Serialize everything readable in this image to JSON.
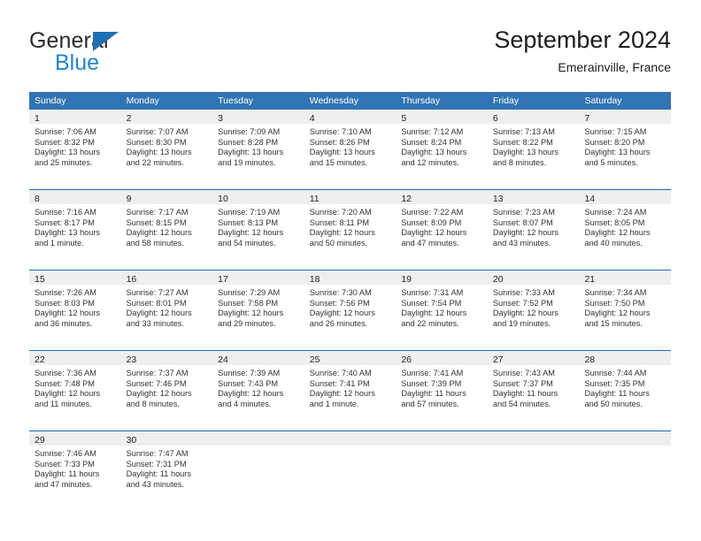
{
  "branding": {
    "name_top": "General",
    "name_bottom": "Blue",
    "triangle_color": "#1f6fb5",
    "bottom_color": "#1f86d0"
  },
  "header": {
    "title": "September 2024",
    "subtitle": "Emerainville, France"
  },
  "theme": {
    "header_blue": "#3174b5",
    "rule_blue": "#1f6fb5",
    "day_band_gray": "#efefef",
    "text_color": "#333333"
  },
  "weekdays": [
    "Sunday",
    "Monday",
    "Tuesday",
    "Wednesday",
    "Thursday",
    "Friday",
    "Saturday"
  ],
  "weeks": [
    [
      {
        "day": "1",
        "sunrise": "Sunrise: 7:06 AM",
        "sunset": "Sunset: 8:32 PM",
        "daylight_line1": "Daylight: 13 hours",
        "daylight_line2": "and 25 minutes."
      },
      {
        "day": "2",
        "sunrise": "Sunrise: 7:07 AM",
        "sunset": "Sunset: 8:30 PM",
        "daylight_line1": "Daylight: 13 hours",
        "daylight_line2": "and 22 minutes."
      },
      {
        "day": "3",
        "sunrise": "Sunrise: 7:09 AM",
        "sunset": "Sunset: 8:28 PM",
        "daylight_line1": "Daylight: 13 hours",
        "daylight_line2": "and 19 minutes."
      },
      {
        "day": "4",
        "sunrise": "Sunrise: 7:10 AM",
        "sunset": "Sunset: 8:26 PM",
        "daylight_line1": "Daylight: 13 hours",
        "daylight_line2": "and 15 minutes."
      },
      {
        "day": "5",
        "sunrise": "Sunrise: 7:12 AM",
        "sunset": "Sunset: 8:24 PM",
        "daylight_line1": "Daylight: 13 hours",
        "daylight_line2": "and 12 minutes."
      },
      {
        "day": "6",
        "sunrise": "Sunrise: 7:13 AM",
        "sunset": "Sunset: 8:22 PM",
        "daylight_line1": "Daylight: 13 hours",
        "daylight_line2": "and 8 minutes."
      },
      {
        "day": "7",
        "sunrise": "Sunrise: 7:15 AM",
        "sunset": "Sunset: 8:20 PM",
        "daylight_line1": "Daylight: 13 hours",
        "daylight_line2": "and 5 minutes."
      }
    ],
    [
      {
        "day": "8",
        "sunrise": "Sunrise: 7:16 AM",
        "sunset": "Sunset: 8:17 PM",
        "daylight_line1": "Daylight: 13 hours",
        "daylight_line2": "and 1 minute."
      },
      {
        "day": "9",
        "sunrise": "Sunrise: 7:17 AM",
        "sunset": "Sunset: 8:15 PM",
        "daylight_line1": "Daylight: 12 hours",
        "daylight_line2": "and 58 minutes."
      },
      {
        "day": "10",
        "sunrise": "Sunrise: 7:19 AM",
        "sunset": "Sunset: 8:13 PM",
        "daylight_line1": "Daylight: 12 hours",
        "daylight_line2": "and 54 minutes."
      },
      {
        "day": "11",
        "sunrise": "Sunrise: 7:20 AM",
        "sunset": "Sunset: 8:11 PM",
        "daylight_line1": "Daylight: 12 hours",
        "daylight_line2": "and 50 minutes."
      },
      {
        "day": "12",
        "sunrise": "Sunrise: 7:22 AM",
        "sunset": "Sunset: 8:09 PM",
        "daylight_line1": "Daylight: 12 hours",
        "daylight_line2": "and 47 minutes."
      },
      {
        "day": "13",
        "sunrise": "Sunrise: 7:23 AM",
        "sunset": "Sunset: 8:07 PM",
        "daylight_line1": "Daylight: 12 hours",
        "daylight_line2": "and 43 minutes."
      },
      {
        "day": "14",
        "sunrise": "Sunrise: 7:24 AM",
        "sunset": "Sunset: 8:05 PM",
        "daylight_line1": "Daylight: 12 hours",
        "daylight_line2": "and 40 minutes."
      }
    ],
    [
      {
        "day": "15",
        "sunrise": "Sunrise: 7:26 AM",
        "sunset": "Sunset: 8:03 PM",
        "daylight_line1": "Daylight: 12 hours",
        "daylight_line2": "and 36 minutes."
      },
      {
        "day": "16",
        "sunrise": "Sunrise: 7:27 AM",
        "sunset": "Sunset: 8:01 PM",
        "daylight_line1": "Daylight: 12 hours",
        "daylight_line2": "and 33 minutes."
      },
      {
        "day": "17",
        "sunrise": "Sunrise: 7:29 AM",
        "sunset": "Sunset: 7:58 PM",
        "daylight_line1": "Daylight: 12 hours",
        "daylight_line2": "and 29 minutes."
      },
      {
        "day": "18",
        "sunrise": "Sunrise: 7:30 AM",
        "sunset": "Sunset: 7:56 PM",
        "daylight_line1": "Daylight: 12 hours",
        "daylight_line2": "and 26 minutes."
      },
      {
        "day": "19",
        "sunrise": "Sunrise: 7:31 AM",
        "sunset": "Sunset: 7:54 PM",
        "daylight_line1": "Daylight: 12 hours",
        "daylight_line2": "and 22 minutes."
      },
      {
        "day": "20",
        "sunrise": "Sunrise: 7:33 AM",
        "sunset": "Sunset: 7:52 PM",
        "daylight_line1": "Daylight: 12 hours",
        "daylight_line2": "and 19 minutes."
      },
      {
        "day": "21",
        "sunrise": "Sunrise: 7:34 AM",
        "sunset": "Sunset: 7:50 PM",
        "daylight_line1": "Daylight: 12 hours",
        "daylight_line2": "and 15 minutes."
      }
    ],
    [
      {
        "day": "22",
        "sunrise": "Sunrise: 7:36 AM",
        "sunset": "Sunset: 7:48 PM",
        "daylight_line1": "Daylight: 12 hours",
        "daylight_line2": "and 11 minutes."
      },
      {
        "day": "23",
        "sunrise": "Sunrise: 7:37 AM",
        "sunset": "Sunset: 7:46 PM",
        "daylight_line1": "Daylight: 12 hours",
        "daylight_line2": "and 8 minutes."
      },
      {
        "day": "24",
        "sunrise": "Sunrise: 7:39 AM",
        "sunset": "Sunset: 7:43 PM",
        "daylight_line1": "Daylight: 12 hours",
        "daylight_line2": "and 4 minutes."
      },
      {
        "day": "25",
        "sunrise": "Sunrise: 7:40 AM",
        "sunset": "Sunset: 7:41 PM",
        "daylight_line1": "Daylight: 12 hours",
        "daylight_line2": "and 1 minute."
      },
      {
        "day": "26",
        "sunrise": "Sunrise: 7:41 AM",
        "sunset": "Sunset: 7:39 PM",
        "daylight_line1": "Daylight: 11 hours",
        "daylight_line2": "and 57 minutes."
      },
      {
        "day": "27",
        "sunrise": "Sunrise: 7:43 AM",
        "sunset": "Sunset: 7:37 PM",
        "daylight_line1": "Daylight: 11 hours",
        "daylight_line2": "and 54 minutes."
      },
      {
        "day": "28",
        "sunrise": "Sunrise: 7:44 AM",
        "sunset": "Sunset: 7:35 PM",
        "daylight_line1": "Daylight: 11 hours",
        "daylight_line2": "and 50 minutes."
      }
    ],
    [
      {
        "day": "29",
        "sunrise": "Sunrise: 7:46 AM",
        "sunset": "Sunset: 7:33 PM",
        "daylight_line1": "Daylight: 11 hours",
        "daylight_line2": "and 47 minutes."
      },
      {
        "day": "30",
        "sunrise": "Sunrise: 7:47 AM",
        "sunset": "Sunset: 7:31 PM",
        "daylight_line1": "Daylight: 11 hours",
        "daylight_line2": "and 43 minutes."
      },
      {
        "day": "",
        "sunrise": "",
        "sunset": "",
        "daylight_line1": "",
        "daylight_line2": ""
      },
      {
        "day": "",
        "sunrise": "",
        "sunset": "",
        "daylight_line1": "",
        "daylight_line2": ""
      },
      {
        "day": "",
        "sunrise": "",
        "sunset": "",
        "daylight_line1": "",
        "daylight_line2": ""
      },
      {
        "day": "",
        "sunrise": "",
        "sunset": "",
        "daylight_line1": "",
        "daylight_line2": ""
      },
      {
        "day": "",
        "sunrise": "",
        "sunset": "",
        "daylight_line1": "",
        "daylight_line2": ""
      }
    ]
  ]
}
